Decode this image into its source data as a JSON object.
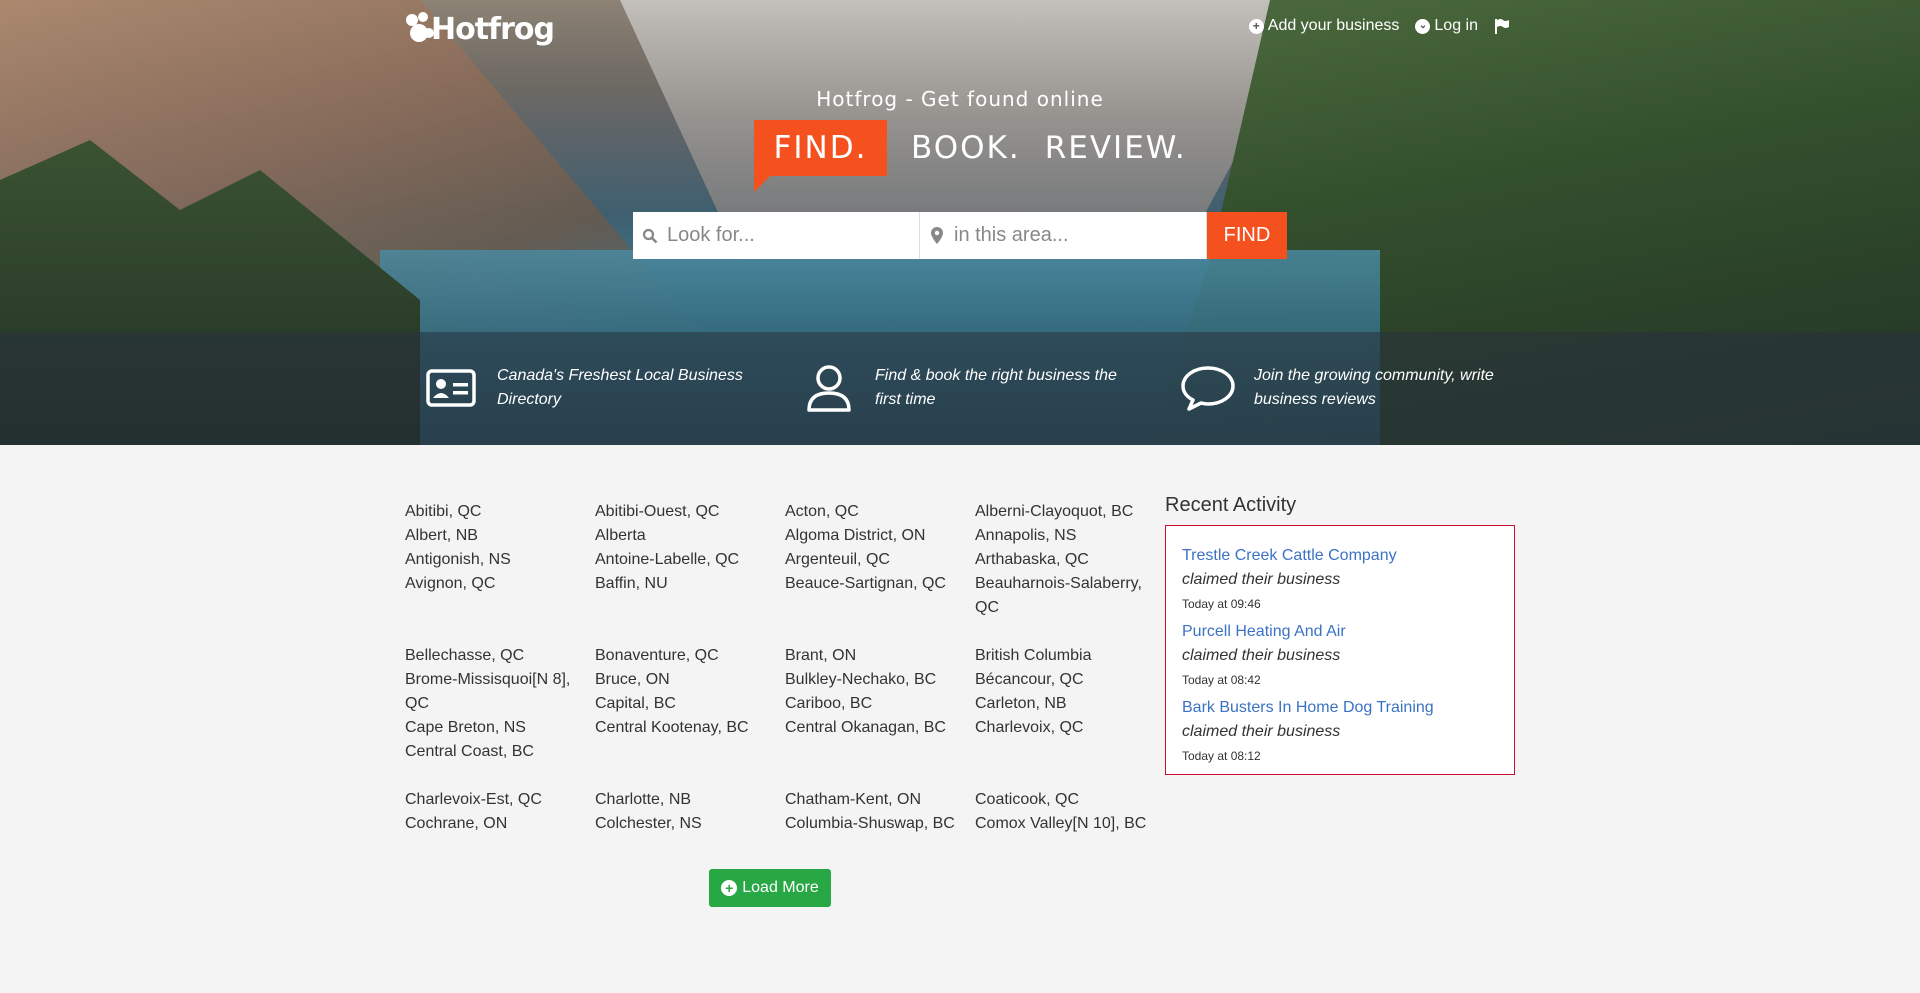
{
  "header": {
    "brand": "Hotfrog",
    "nav": {
      "add_business": "Add your business",
      "login": "Log in"
    }
  },
  "hero": {
    "tagline": "Hotfrog - Get found online",
    "words": [
      "FIND.",
      "BOOK.",
      "REVIEW."
    ]
  },
  "search": {
    "look_for_placeholder": "Look for...",
    "area_placeholder": "in this area...",
    "button": "FIND"
  },
  "features": [
    {
      "icon": "id-card-icon",
      "text": "Canada's Freshest Local Business Directory"
    },
    {
      "icon": "user-icon",
      "text": "Find & book the right business the first time"
    },
    {
      "icon": "chat-bubble-icon",
      "text": "Join the growing community, write business reviews"
    }
  ],
  "locations": [
    [
      [
        "Abitibi, QC",
        "Albert, NB",
        "Antigonish, NS",
        "Avignon, QC"
      ],
      [
        "Abitibi-Ouest, QC",
        "Alberta",
        "Antoine-Labelle, QC",
        "Baffin, NU"
      ],
      [
        "Acton, QC",
        "Algoma District, ON",
        "Argenteuil, QC",
        "Beauce-Sartignan, QC"
      ],
      [
        "Alberni-Clayoquot, BC",
        "Annapolis, NS",
        "Arthabaska, QC",
        "Beauharnois-Salaberry, QC"
      ]
    ],
    [
      [
        "Bellechasse, QC",
        "Brome-Missisquoi[N 8], QC",
        "Cape Breton, NS",
        "Central Coast, BC"
      ],
      [
        "Bonaventure, QC",
        "Bruce, ON",
        "Capital, BC",
        "Central Kootenay, BC"
      ],
      [
        "Brant, ON",
        "Bulkley-Nechako, BC",
        "Cariboo, BC",
        "Central Okanagan, BC"
      ],
      [
        "British Columbia",
        "Bécancour, QC",
        "Carleton, NB",
        "Charlevoix, QC"
      ]
    ],
    [
      [
        "Charlevoix-Est, QC",
        "Cochrane, ON"
      ],
      [
        "Charlotte, NB",
        "Colchester, NS"
      ],
      [
        "Chatham-Kent, ON",
        "Columbia-Shuswap, BC"
      ],
      [
        "Coaticook, QC",
        "Comox Valley[N 10], BC"
      ]
    ]
  ],
  "load_more": "Load More",
  "recent": {
    "title": "Recent Activity",
    "items": [
      {
        "name": "Trestle Creek Cattle Company",
        "action": "claimed their business",
        "time": "Today at 09:46"
      },
      {
        "name": "Purcell Heating And Air",
        "action": "claimed their business",
        "time": "Today at 08:42"
      },
      {
        "name": "Bark Busters In Home Dog Training",
        "action": "claimed their business",
        "time": "Today at 08:12"
      }
    ]
  },
  "colors": {
    "accent": "#f4511e",
    "load_more": "#28a745",
    "link": "#3b72c4",
    "recent_border": "#c8102e"
  }
}
